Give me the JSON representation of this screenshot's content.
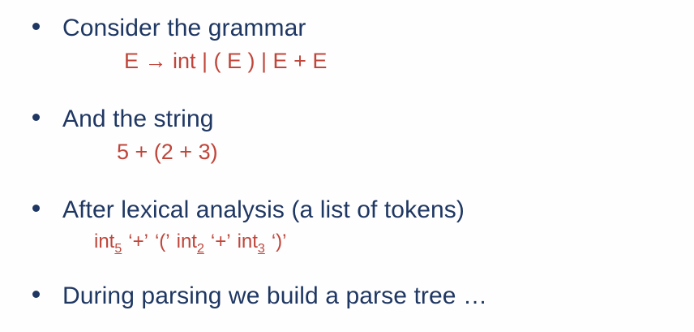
{
  "bullets": [
    {
      "text": "Consider the grammar"
    },
    {
      "text": "And the string"
    },
    {
      "text": "After lexical analysis (a list of tokens)"
    },
    {
      "text": "During parsing we build a parse tree …"
    }
  ],
  "grammar": "E → int | ( E ) | E + E",
  "input_string": "5 + (2 + 3)",
  "tokens": [
    {
      "text": "int",
      "sub": "5"
    },
    {
      "text": "‘+’",
      "sub": ""
    },
    {
      "text": "‘(’",
      "sub": ""
    },
    {
      "text": "int",
      "sub": "2"
    },
    {
      "text": "‘+’",
      "sub": ""
    },
    {
      "text": "int",
      "sub": "3"
    },
    {
      "text": "‘)’",
      "sub": ""
    }
  ],
  "colors": {
    "bullet_text": "#1f3763",
    "example_text": "#c0453a"
  }
}
